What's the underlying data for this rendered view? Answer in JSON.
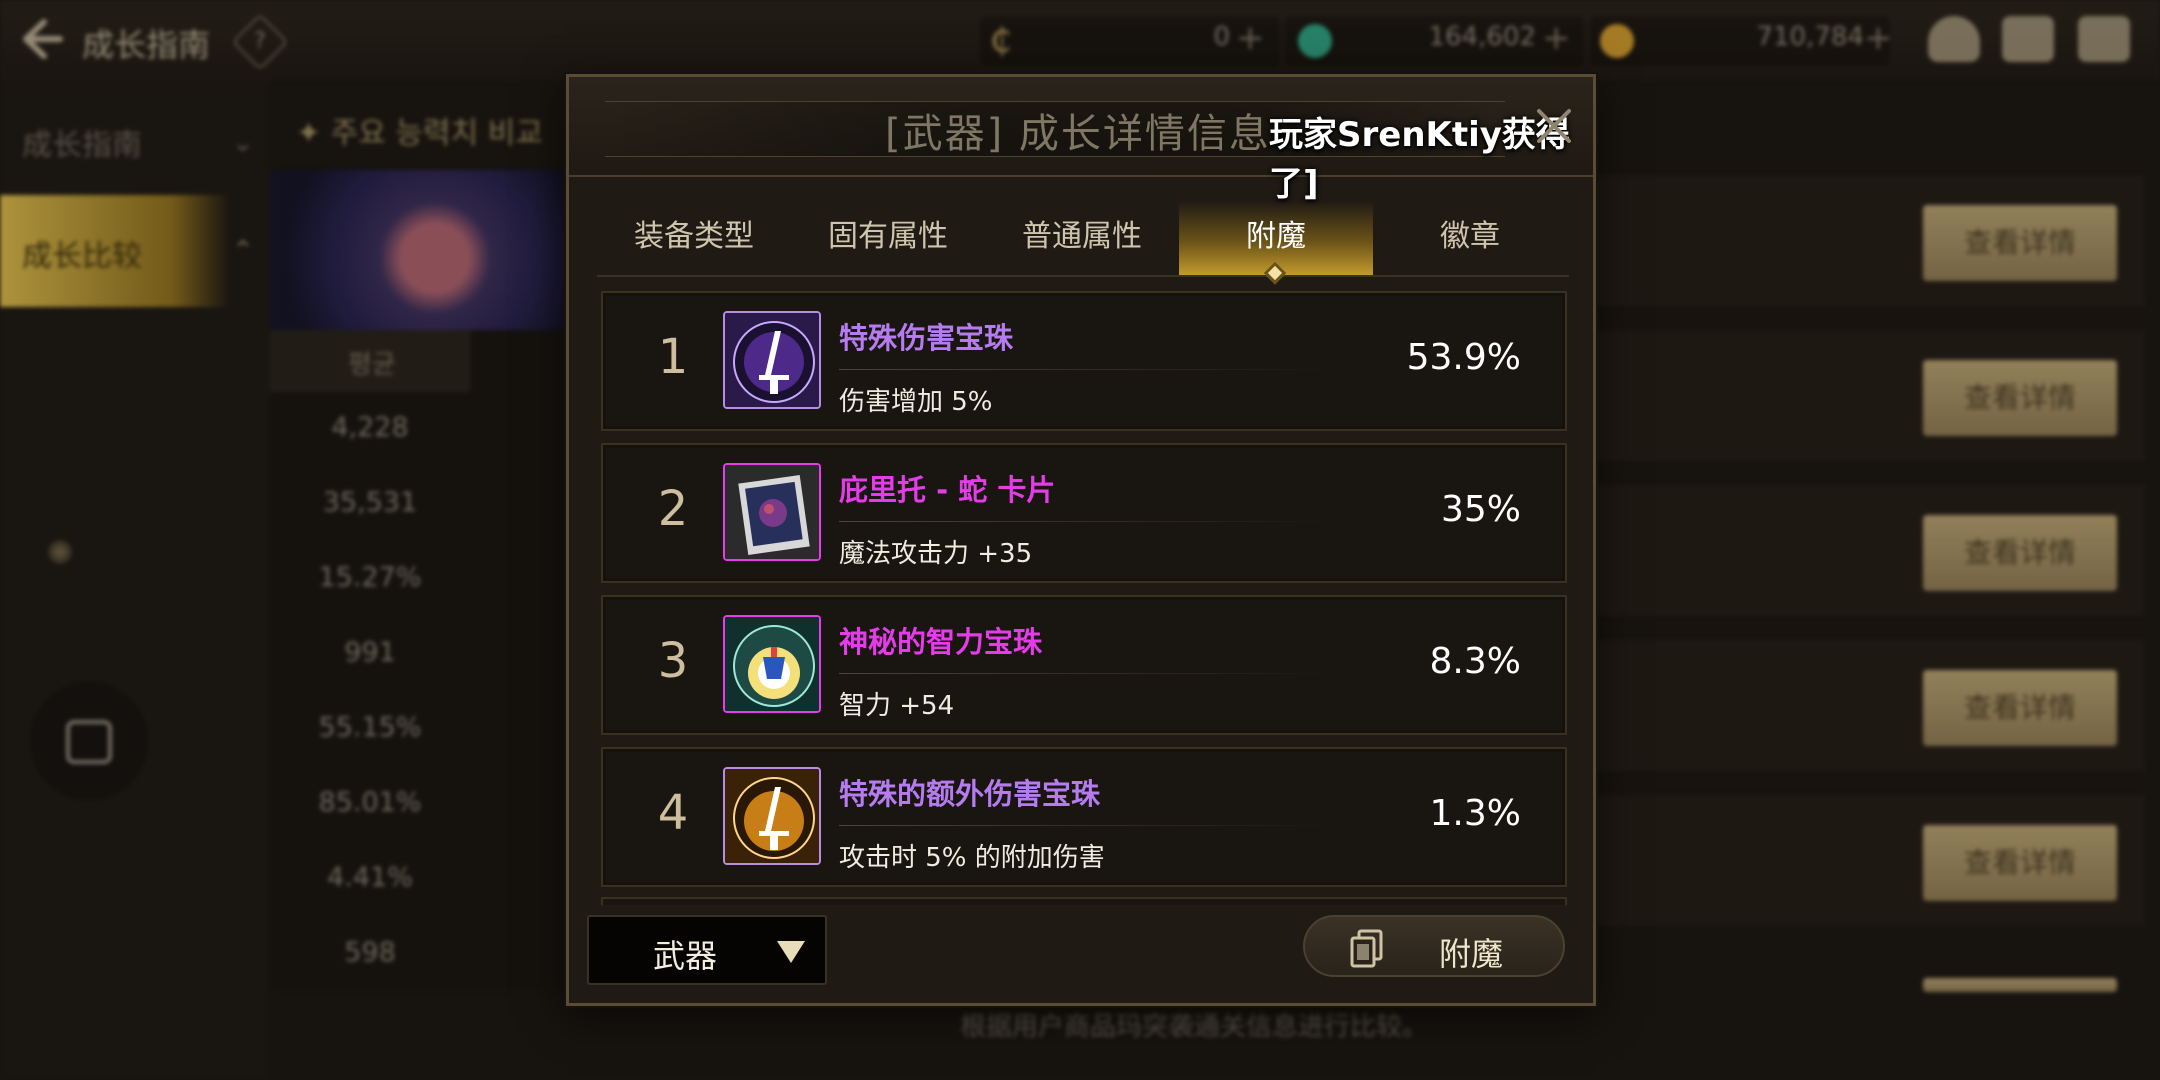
{
  "topbar": {
    "title": "成长指南",
    "help": "?",
    "currencies": [
      {
        "icon": "c-coin-icon",
        "value": "0",
        "color": "#b59a5a"
      },
      {
        "icon": "green-gem-icon",
        "value": "164,602",
        "color": "#2f9e7e"
      },
      {
        "icon": "gold-coin-icon",
        "value": "710,784",
        "color": "#c9962c"
      }
    ]
  },
  "sidebar": {
    "items": [
      {
        "label": "成长指南",
        "chevron": "⌄"
      },
      {
        "label": "成长比较",
        "chevron": "⌃"
      }
    ]
  },
  "background": {
    "compare_header": "주요 능력치 비교",
    "stat_header": "평균",
    "stats": [
      "4,228",
      "35,531",
      "15.27%",
      "991",
      "55.15%",
      "85.01%",
      "4.41%",
      "598"
    ],
    "detail_button": "查看详情",
    "footer_note": "根据用户商品玛突袭通关信息进行比较。"
  },
  "dialog": {
    "title": "[武器] 成长详情信息",
    "ticker": "玩家SrenKtiy获得了]",
    "tabs": [
      {
        "label": "装备类型",
        "active": false
      },
      {
        "label": "固有属性",
        "active": false
      },
      {
        "label": "普通属性",
        "active": false
      },
      {
        "label": "附魔",
        "active": true
      },
      {
        "label": "徽章",
        "active": false
      }
    ],
    "rows": [
      {
        "rank": "1",
        "name": "特殊伤害宝珠",
        "name_color": "#b57cf0",
        "desc": "伤害增加 5%",
        "percent": "53.9%",
        "icon": "purple-sword-orb-icon"
      },
      {
        "rank": "2",
        "name": "庇里托 - 蛇 卡片",
        "name_color": "#e33ce8",
        "desc": "魔法攻击力 +35",
        "percent": "35%",
        "icon": "serpent-card-icon"
      },
      {
        "rank": "3",
        "name": "神秘的智力宝珠",
        "name_color": "#e33ce8",
        "desc": "智力 +54",
        "percent": "8.3%",
        "icon": "intelligence-orb-icon"
      },
      {
        "rank": "4",
        "name": "特殊的额外伤害宝珠",
        "name_color": "#b57cf0",
        "desc": "攻击时 5% 的附加伤害",
        "percent": "1.3%",
        "icon": "gold-sword-orb-icon"
      }
    ],
    "footer": {
      "select_value": "武器",
      "enchant_label": "附魔"
    }
  }
}
